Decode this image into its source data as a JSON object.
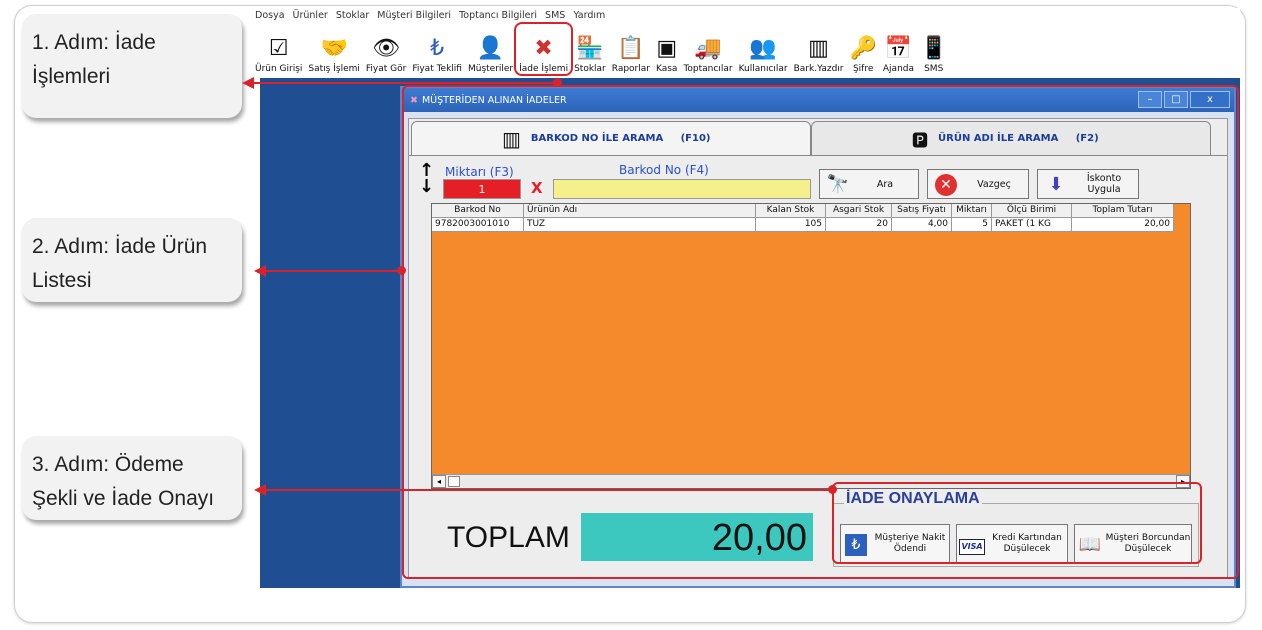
{
  "callouts": [
    {
      "text": "1. Adım: İade İşlemleri"
    },
    {
      "text": "2. Adım: İade Ürün Listesi"
    },
    {
      "text": "3. Adım: Ödeme Şekli ve İade Onayı"
    }
  ],
  "menu": [
    "Dosya",
    "Ürünler",
    "Stoklar",
    "Müşteri Bilgileri",
    "Toptancı Bilgileri",
    "SMS",
    "Yardım"
  ],
  "toolbar": [
    {
      "label": "Ürün Girişi",
      "icon": "☑"
    },
    {
      "label": "Satış İşlemi",
      "icon": "🤝"
    },
    {
      "label": "Fiyat Gör",
      "icon": "👁"
    },
    {
      "label": "Fiyat Teklifi",
      "icon": "₺"
    },
    {
      "label": "Müşteriler",
      "icon": "👤"
    },
    {
      "label": "İade İşlemi",
      "icon": "✖"
    },
    {
      "label": "Stoklar",
      "icon": "🏪"
    },
    {
      "label": "Raporlar",
      "icon": "📋"
    },
    {
      "label": "Kasa",
      "icon": "▣"
    },
    {
      "label": "Toptancılar",
      "icon": "🚚"
    },
    {
      "label": "Kullanıcılar",
      "icon": "👥"
    },
    {
      "label": "Bark.Yazdır",
      "icon": "▥"
    },
    {
      "label": "Şifre",
      "icon": "🔑"
    },
    {
      "label": "Ajanda",
      "icon": "📅"
    },
    {
      "label": "SMS",
      "icon": "📱"
    }
  ],
  "dialog": {
    "title": "MÜŞTERİDEN ALINAN İADELER",
    "tab_barcode": "BARKOD NO İLE ARAMA     (F10)",
    "tab_name": "ÜRÜN ADI İLE ARAMA     (F2)",
    "miktar_label": "Miktarı (F3)",
    "barkod_label": "Barkod No (F4)",
    "miktar_value": "1",
    "x_mark": "X",
    "btn_ara": "Ara",
    "btn_vazgec": "Vazgeç",
    "btn_iskonto": "İskonto Uygula",
    "grid": {
      "headers": [
        "Barkod No",
        "Ürünün Adı",
        "Kalan Stok",
        "Asgari Stok",
        "Satış Fiyatı",
        "Miktarı",
        "Ölçü Birimi",
        "Toplam Tutarı"
      ],
      "rows": [
        [
          "9782003001010",
          "TUZ",
          "105",
          "20",
          "4,00",
          "5",
          "PAKET (1 KG",
          "20,00"
        ]
      ]
    },
    "toplam_label": "TOPLAM",
    "toplam_value": "20,00",
    "onay_title": "İADE ONAYLAMA",
    "onay_btn1": "Müşteriye Nakit Ödendi",
    "onay_btn2": "Kredi Kartından Düşülecek",
    "onay_btn3": "Müşteri Borcundan Düşülecek",
    "visa": "VISA"
  }
}
